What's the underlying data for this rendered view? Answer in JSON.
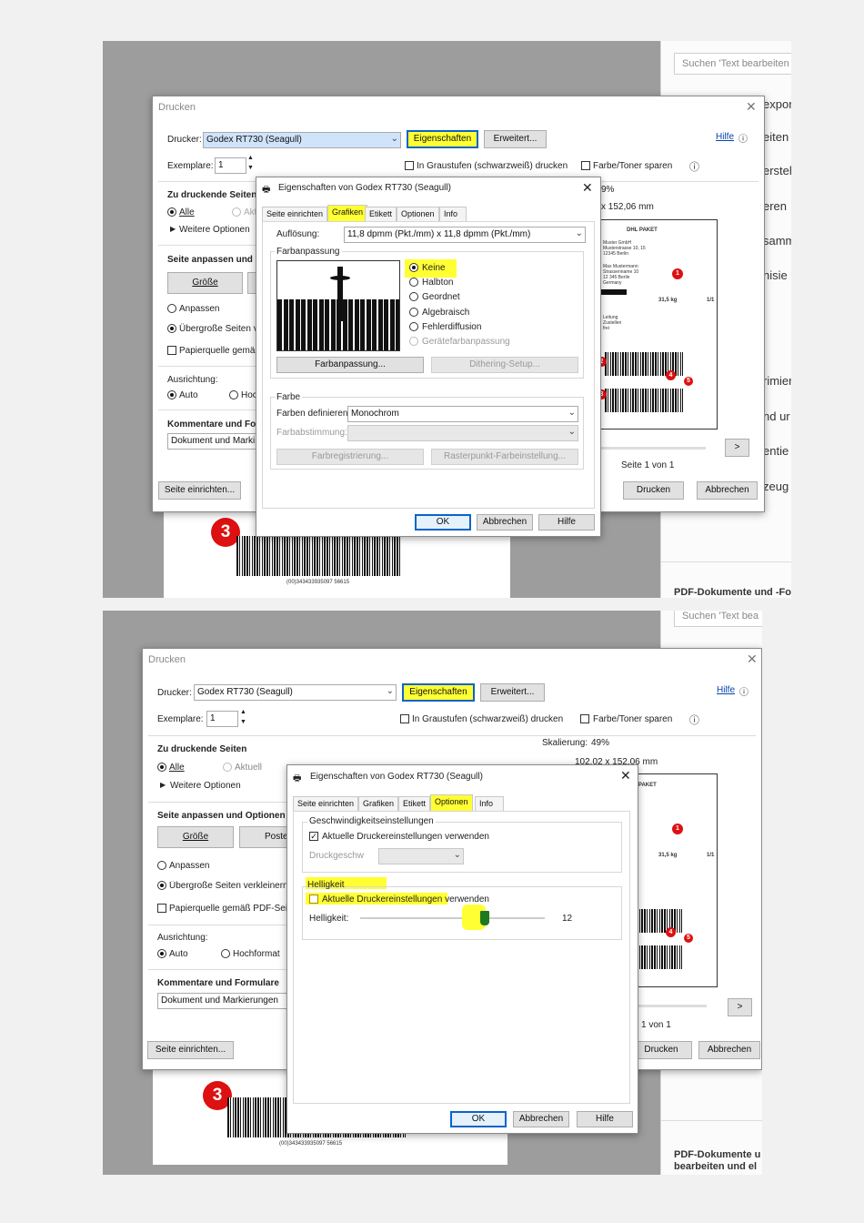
{
  "bg_right": {
    "search_placeholder": "Suchen 'Text bearbeiten",
    "search_placeholder_b": "Suchen 'Text bea",
    "items": [
      "expor",
      "eiten",
      "erstel",
      "eren",
      "samm",
      "nisie",
      "rimier",
      "nd ur",
      "entie",
      "zeug"
    ],
    "footer": "PDF-Dokumente und -Fo",
    "footer_b_1": "PDF-Dokumente u",
    "footer_b_2": "bearbeiten und el"
  },
  "barcode_text": "(00)343433935097 56615",
  "badges": {
    "a": "1",
    "b": "2",
    "c": "3",
    "d": "4",
    "e": "5",
    "big": "3"
  },
  "label_preview": {
    "carrier": "DHL PAKET",
    "from": [
      "Muster GmbH",
      "Musterstrasse 10, 15",
      "12345 Berlin",
      "Germany"
    ],
    "to": [
      "Max Mustermann",
      "Strassenname 10",
      "12 345 Berlin",
      "Germany"
    ],
    "weight": "31,5 kg",
    "count": "1/1",
    "note": [
      "Leitung",
      "Zustellen",
      "frei"
    ]
  },
  "print_dialog": {
    "title": "Drucken",
    "printer_label": "Drucker:",
    "printer_value": "Godex RT730 (Seagull)",
    "properties_btn": "Eigenschaften",
    "advanced_btn": "Erweitert...",
    "help_link": "Hilfe",
    "copies_label": "Exemplare:",
    "copies_value": "1",
    "grayscale_label": "In Graustufen (schwarzweiß) drucken",
    "toner_label": "Farbe/Toner sparen",
    "pages_heading": "Zu druckende Seiten",
    "pages_all": "Alle",
    "pages_current": "Aktuell",
    "pages_current_short": "Akt",
    "more_options": "Weitere Optionen",
    "fit_heading": "Seite anpassen und Optionen",
    "fit_heading_short": "Seite anpassen und O",
    "size_btn": "Größe",
    "poster_btn": "Poste",
    "fit_option": "Anpassen",
    "oversize_option": "Übergroße Seiten verkleinern",
    "oversize_option_short": "Übergroße Seiten v",
    "paper_source": "Papierquelle gemäß PDF-Seit",
    "paper_source_short": "Papierquelle gemäß",
    "orientation_heading": "Ausrichtung:",
    "orient_auto": "Auto",
    "orient_portrait": "Hochformat",
    "orient_portrait_short": "Hoc",
    "comments_heading": "Kommentare und Formulare",
    "comments_heading_short": "Kommentare und For",
    "comments_value": "Dokument und Markierungen",
    "comments_value_short": "Dokument und Marki",
    "scale_label": "Skalierung:",
    "scale_value": "49%",
    "scale_value_a": "9%",
    "dimensions": "102,02 x 152,06 mm",
    "dimensions_a": "x 152,06 mm",
    "page_counter": "Seite 1 von 1",
    "page_counter_b": "1 von 1",
    "next_btn": ">",
    "page_setup_btn": "Seite einrichten...",
    "print_btn": "Drucken",
    "cancel_btn": "Abbrechen"
  },
  "props_a": {
    "title": "Eigenschaften von Godex RT730 (Seagull)",
    "tabs": [
      "Seite einrichten",
      "Grafiken",
      "Etikett",
      "Optionen",
      "Info"
    ],
    "resolution_label": "Auflösung:",
    "resolution_value": "11,8 dpmm (Pkt./mm) x 11,8 dpmm (Pkt./mm)",
    "dithering_heading": "Farbanpassung",
    "dither_options": [
      "Keine",
      "Halbton",
      "Geordnet",
      "Algebraisch",
      "Fehlerdiffusion",
      "Gerätefarbanpassung"
    ],
    "color_adjust_btn": "Farbanpassung...",
    "dither_setup_btn": "Dithering-Setup...",
    "color_heading": "Farbe",
    "define_colors_label": "Farben definieren:",
    "define_colors_value": "Monochrom",
    "color_match_label": "Farbabstimmung:",
    "color_reg_btn": "Farbregistrierung...",
    "raster_btn": "Rasterpunkt-Farbeinstellung...",
    "ok_btn": "OK",
    "cancel_btn": "Abbrechen",
    "help_btn": "Hilfe"
  },
  "props_b": {
    "title": "Eigenschaften von Godex RT730 (Seagull)",
    "tabs": [
      "Seite einrichten",
      "Grafiken",
      "Etikett",
      "Optionen",
      "Info"
    ],
    "speed_heading": "Geschwindigkeitseinstellungen",
    "speed_checkbox": "Aktuelle Druckereinstellungen verwenden",
    "speed_label": "Druckgeschw",
    "brightness_heading": "Helligkeit",
    "brightness_checkbox": "Aktuelle Druckereinstellungen verwenden",
    "brightness_label": "Helligkeit:",
    "brightness_value": "12",
    "brightness_level": 0.5,
    "ok_btn": "OK",
    "cancel_btn": "Abbrechen",
    "help_btn": "Hilfe"
  },
  "colors": {
    "highlight": "#ffff33",
    "accent": "#0a64c8",
    "badge": "#dd1111",
    "slider_thumb": "#1e7a1e"
  },
  "icons": [
    "close-icon",
    "help-circle-icon",
    "info-icon",
    "printer-icon",
    "chevron-down-icon",
    "spin-up-icon",
    "spin-down-icon",
    "triangle-right-icon",
    "checkmark-icon"
  ]
}
